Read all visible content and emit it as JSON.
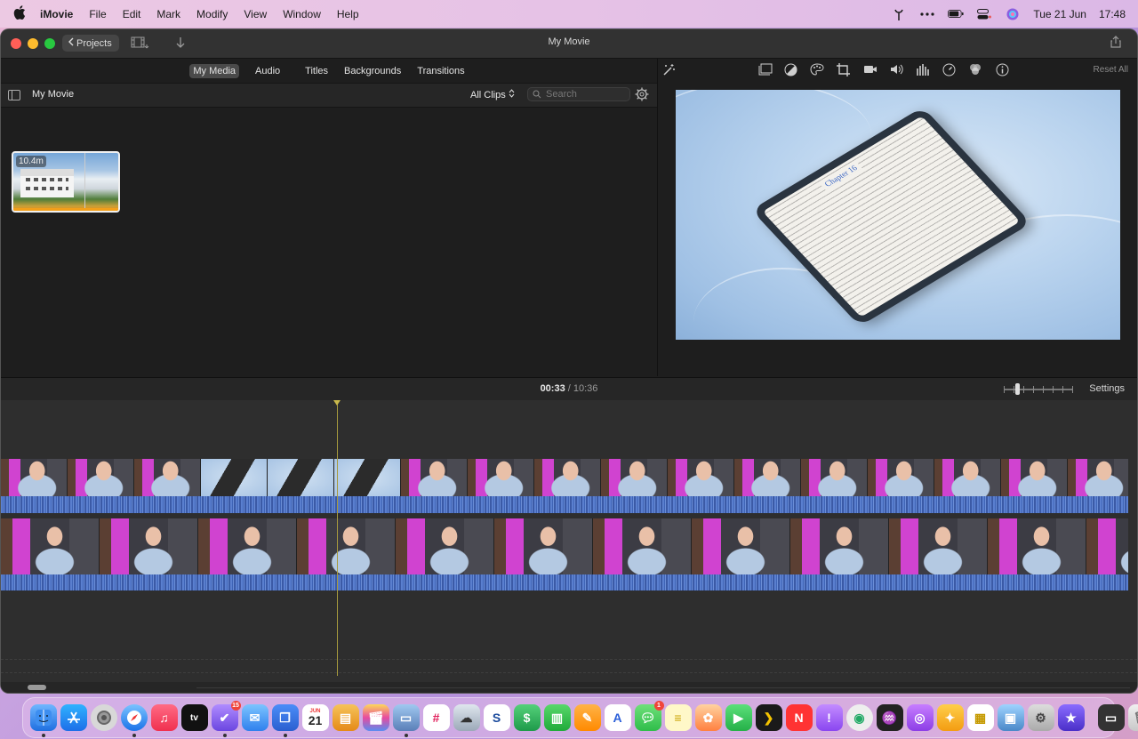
{
  "menubar": {
    "app_name": "iMovie",
    "items": [
      "File",
      "Edit",
      "Mark",
      "Modify",
      "View",
      "Window",
      "Help"
    ],
    "date": "Tue 21 Jun",
    "time": "17:48"
  },
  "window": {
    "title": "My Movie",
    "projects_label": "Projects"
  },
  "browser": {
    "tabs": [
      "My Media",
      "Audio",
      "Titles",
      "Backgrounds",
      "Transitions"
    ],
    "active_tab": "My Media",
    "library_title": "My Movie",
    "filter_label": "All Clips",
    "search_placeholder": "Search",
    "clips": [
      {
        "duration": "10.4m"
      }
    ]
  },
  "viewer": {
    "reset_label": "Reset All",
    "ipad_heading": "Chapter 16"
  },
  "timeline": {
    "current_time": "00:33",
    "separator": "/",
    "total_time": "10:36",
    "settings_label": "Settings"
  },
  "dock": {
    "calendar_month": "JUN",
    "calendar_day": "21",
    "badges": {
      "tasks": "15",
      "messages": "1"
    }
  },
  "colors": {
    "accent_orange": "#f29f1a",
    "playhead": "#a79a3e",
    "audio_wave": "#3f64b6"
  }
}
